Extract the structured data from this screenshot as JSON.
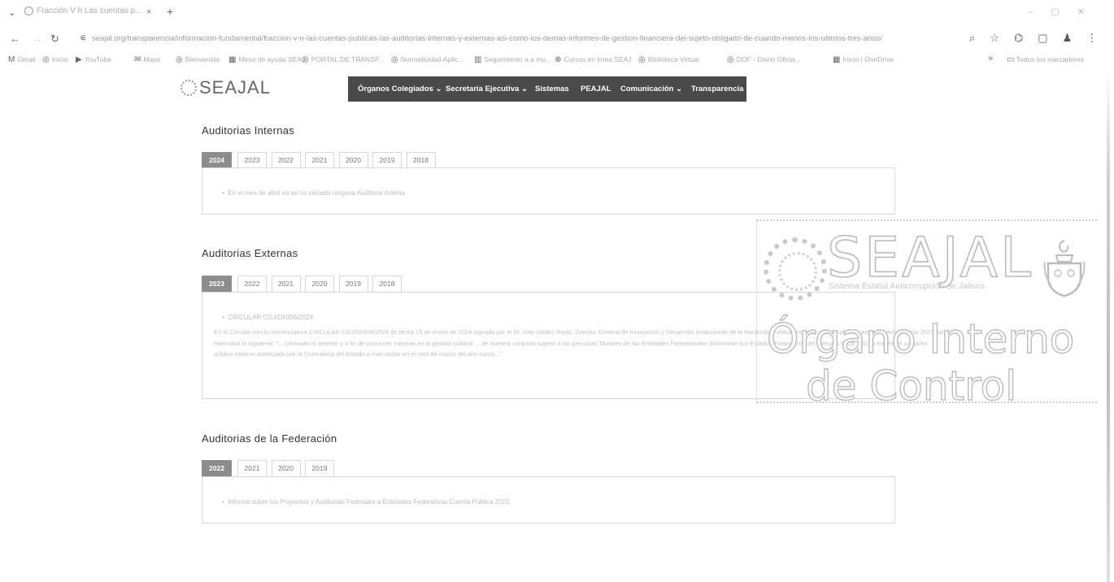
{
  "browser": {
    "tab_title": "Fracción V h Las cuentas p...",
    "tab_close": "×",
    "new_tab": "+",
    "url": "seajal.org/transparencia/informacion-fundamental/fraccion-v-n-las-cuentas-publicas-las-auditorias-internas-y-externas-asi-como-los-demas-informes-de-gestion-financiera-del-sujeto-obligado-de-cuando-menos-los-ultimos-tres-anos/",
    "bookmarks": [
      {
        "icon": "M",
        "label": "Gmail"
      },
      {
        "icon": "◎",
        "label": "Inicio"
      },
      {
        "icon": "▶",
        "label": "YouTube"
      },
      {
        "icon": "✉",
        "label": "Maps"
      },
      {
        "icon": "◎",
        "label": "Bienvenida"
      },
      {
        "icon": "▦",
        "label": "Mesa de ayuda SEAJ"
      },
      {
        "icon": "◎",
        "label": "PORTAL DE TRANSP..."
      },
      {
        "icon": "◎",
        "label": "Normatividad Aplic..."
      },
      {
        "icon": "▥",
        "label": "Seguimiento a a mu..."
      },
      {
        "icon": "⊕",
        "label": "Cursos en línea SEAJ"
      },
      {
        "icon": "◎",
        "label": "Biblioteca Virtual"
      },
      {
        "icon": "◎",
        "label": "DOF - Diario Oficia..."
      },
      {
        "icon": "▦",
        "label": "Inicio | OneDrive"
      }
    ],
    "bookmarks_more": "»",
    "all_bookmarks": "Todos los marcadores"
  },
  "site": {
    "logo": "SEAJAL",
    "nav": [
      {
        "label": "Órganos Colegiados ⌄"
      },
      {
        "label": "Secretaría Ejecutiva ⌄"
      },
      {
        "label": "Sistemas"
      },
      {
        "label": "PEAJAL"
      },
      {
        "label": "Comunicación ⌄"
      },
      {
        "label": "Transparencia"
      }
    ]
  },
  "sections": {
    "internas": {
      "title": "Auditorias Internas",
      "years": [
        "2024",
        "2023",
        "2022",
        "2021",
        "2020",
        "2019",
        "2018"
      ],
      "active": "2024",
      "item": "En el mes de abril no se ha iniciado ninguna Auditoria Interna"
    },
    "externas": {
      "title": "Auditorias Externas",
      "years": [
        "2023",
        "2022",
        "2021",
        "2020",
        "2019",
        "2018"
      ],
      "active": "2023",
      "item": "CIRCULAR CGJ/DI/006/2024",
      "paragraph": "En la Circular con la nomenclatura CIRCULAR CGJ/DI/006/2024 de fecha 15 de enero de 2024 signada por el Dr. Iván Valdez Rojas, Director General de Innovación y Desarrollo Institucional de la Hacienda Pública respecto a las auditorias externas del ejercicio 2023, se menciona lo siguiente: \"... Derivado lo anterior y a fin de promover mejoras en la gestión pública ... de manera conjunta sugerir a las personas Titulares de las Entidades Paraestatales dictaminar sus Estados Financieros del ejercicio fiscal 2023 a través de contador público externo autorizado por la Contraloría del Estado a más tardar en el mes de marzo del año curso...\""
    },
    "federacion": {
      "title": "Auditorias de la Federación",
      "years": [
        "2022",
        "2021",
        "2020",
        "2019"
      ],
      "active": "2022",
      "item": "Informe sobre los Proyectos y Auditorías Federales a Entidades Federativas Cuenta Pública 2022"
    }
  },
  "stamp": {
    "brand": "SEAJAL",
    "tagline": "Sistema Estatal Anticorrupción de Jalisco",
    "line1": "Órgano Interno",
    "line2": "de Control"
  }
}
